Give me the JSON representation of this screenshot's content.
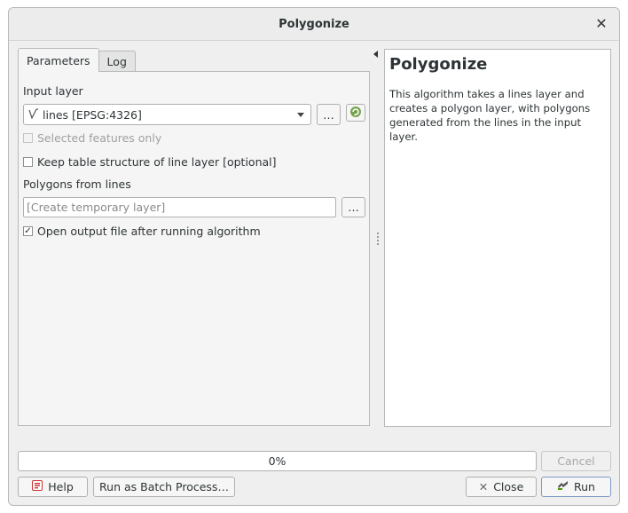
{
  "window": {
    "title": "Polygonize"
  },
  "tabs": [
    {
      "label": "Parameters",
      "active": true
    },
    {
      "label": "Log",
      "active": false
    }
  ],
  "params": {
    "input_layer_label": "Input layer",
    "input_layer_value": "lines [EPSG:4326]",
    "input_layer_icon": "line-layer-icon",
    "browse_label": "…",
    "selected_only_label": "Selected features only",
    "selected_only_checked": false,
    "keep_table_label": "Keep table structure of line layer [optional]",
    "keep_table_checked": false,
    "output_label": "Polygons from lines",
    "output_placeholder": "[Create temporary layer]",
    "output_browse_label": "…",
    "open_output_label": "Open output file after running algorithm",
    "open_output_checked": true
  },
  "help": {
    "title": "Polygonize",
    "description": "This algorithm takes a lines layer and creates a polygon layer, with polygons generated from the lines in the input layer."
  },
  "progress": {
    "text": "0%",
    "value": 0
  },
  "buttons": {
    "cancel": "Cancel",
    "help": "Help",
    "batch": "Run as Batch Process…",
    "close": "Close",
    "run": "Run"
  },
  "colors": {
    "accent_green": "#4e9a06",
    "help_red": "#cc0000"
  }
}
